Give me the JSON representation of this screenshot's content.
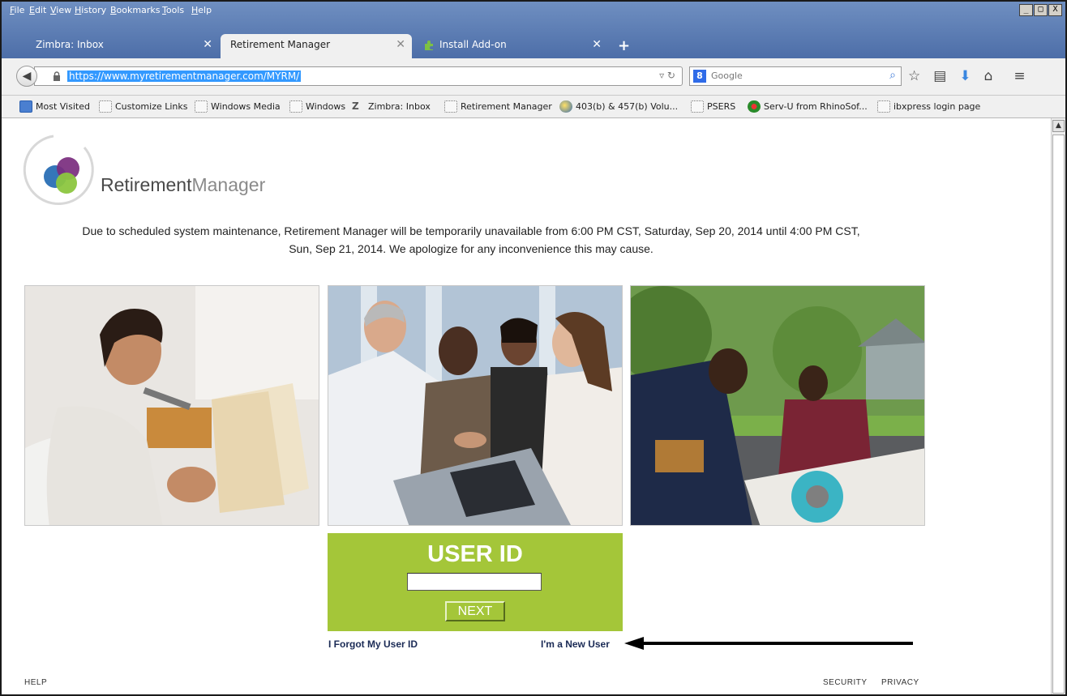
{
  "menu": [
    "File",
    "Edit",
    "View",
    "History",
    "Bookmarks",
    "Tools",
    "Help"
  ],
  "window_buttons": [
    "_",
    "□",
    "X"
  ],
  "tabs": [
    {
      "label": "Zimbra: Inbox",
      "close": "✕"
    },
    {
      "label": "Retirement Manager",
      "close": "✕"
    },
    {
      "label": "Install Add-on",
      "close": "✕"
    }
  ],
  "new_tab": "+",
  "url": "https://www.myretirementmanager.com/MYRM/",
  "search_placeholder": "Google",
  "bookmarks": [
    "Most Visited",
    "Customize Links",
    "Windows Media",
    "Windows",
    "Zimbra: Inbox",
    "Retirement Manager",
    "403(b) & 457(b) Volu...",
    "PSERS",
    "Serv-U from RhinoSof...",
    "ibxpress login page"
  ],
  "logo": {
    "part1": "Retirement",
    "part2": "Manager"
  },
  "notice_line1": "Due to scheduled system maintenance, Retirement Manager will be temporarily unavailable from 6:00 PM CST, Saturday, Sep 20, 2014 until 4:00 PM CST,",
  "notice_line2": "Sun, Sep 21, 2014. We apologize for any inconvenience this may cause.",
  "login": {
    "title": "USER ID",
    "input_value": "",
    "next_label": "NEXT"
  },
  "links": {
    "forgot": "I Forgot My User ID",
    "new_user": "I'm a New User"
  },
  "footer": {
    "help": "HELP",
    "security": "SECURITY",
    "privacy": "PRIVACY"
  },
  "colors": {
    "brand_green": "#a4c639",
    "link_navy": "#1a2a55"
  }
}
